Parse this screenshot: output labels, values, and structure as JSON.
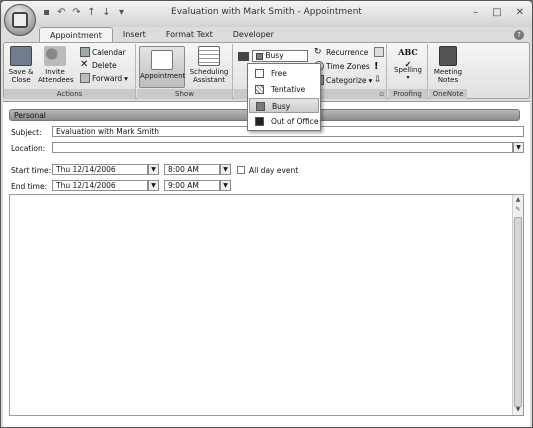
{
  "window": {
    "title": "Evaluation with Mark Smith - Appointment"
  },
  "tabs": [
    "Appointment",
    "Insert",
    "Format Text",
    "Developer"
  ],
  "ribbon": {
    "actions": {
      "label": "Actions",
      "save_close": "Save &\nClose",
      "invite": "Invite\nAttendees",
      "calendar": "Calendar",
      "delete": "Delete",
      "forward": "Forward"
    },
    "show": {
      "label": "Show",
      "appointment": "Appointment",
      "scheduling": "Scheduling\nAssistant"
    },
    "options": {
      "show_as_value": "Busy",
      "recurrence": "Recurrence",
      "time_zones": "Time Zones",
      "categorize": "Categorize"
    },
    "proofing": {
      "label": "Proofing",
      "spelling": "Spelling"
    },
    "onenote": {
      "label": "OneNote",
      "meeting_notes": "Meeting\nNotes"
    }
  },
  "show_as_menu": {
    "items": [
      {
        "label": "Free",
        "swatch": "#ffffff"
      },
      {
        "label": "Tentative",
        "swatch": "#d8d8d8"
      },
      {
        "label": "Busy",
        "swatch": "#7a7a7a"
      },
      {
        "label": "Out of Office",
        "swatch": "#222222"
      }
    ],
    "highlighted": "Busy"
  },
  "form": {
    "category": "Personal",
    "subject_label": "Subject:",
    "subject_value": "Evaluation with Mark Smith",
    "location_label": "Location:",
    "location_value": "",
    "start_label": "Start time:",
    "start_date": "Thu 12/14/2006",
    "start_time": "8:00 AM",
    "all_day_label": "All day event",
    "end_label": "End time:",
    "end_date": "Thu 12/14/2006",
    "end_time": "9:00 AM"
  },
  "colors": {
    "accent_gray": "#9a9a9a"
  }
}
